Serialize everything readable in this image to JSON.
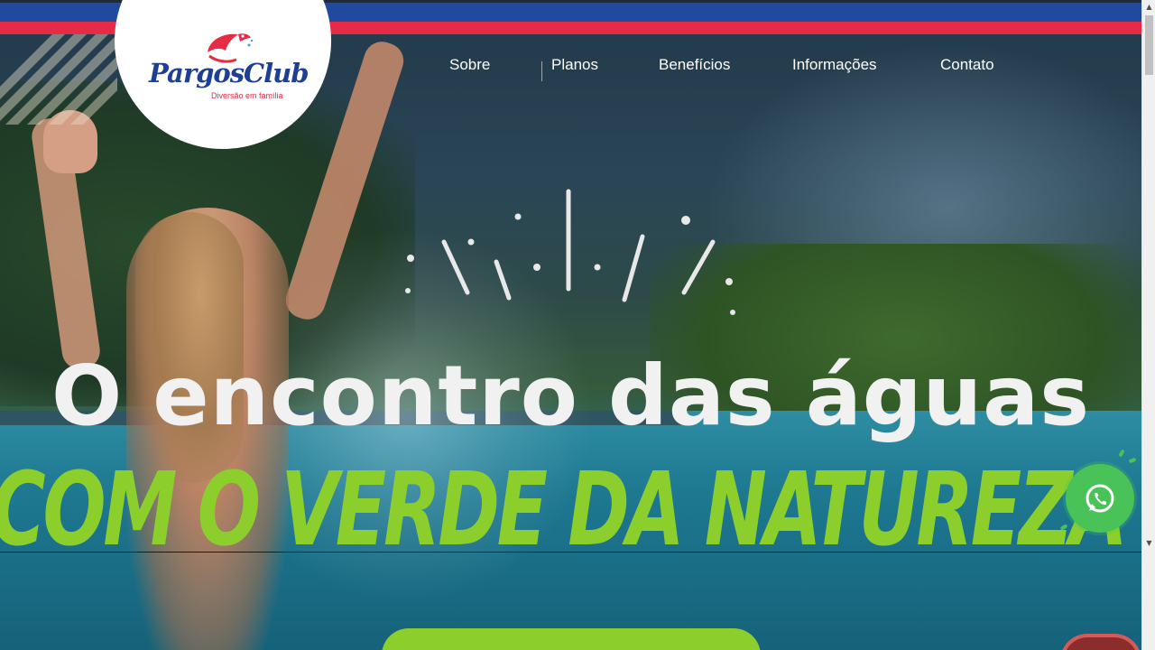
{
  "brand": {
    "name_part1": "Pargos",
    "name_part2": "Club",
    "tagline": "Diversão em família",
    "colors": {
      "blue": "#1f4aa0",
      "red": "#e52b45",
      "green": "#8ccf2d",
      "whatsapp": "#49c257"
    }
  },
  "nav": {
    "items": [
      {
        "label": "Sobre"
      },
      {
        "label": "Planos"
      },
      {
        "label": "Benefícios"
      },
      {
        "label": "Informações"
      },
      {
        "label": "Contato"
      }
    ]
  },
  "hero": {
    "headline": "O encontro das águas",
    "subheadline": "COM O VERDE DA NATUREZA"
  },
  "floating": {
    "whatsapp_icon": "whatsapp-icon"
  },
  "scrollbar": {
    "up_icon": "▲",
    "down_icon": "▼"
  }
}
